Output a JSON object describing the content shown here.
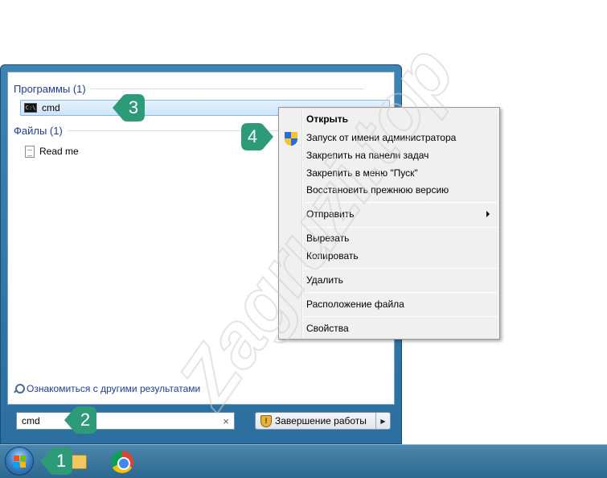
{
  "search_results": {
    "programs_header": "Программы (1)",
    "programs": [
      {
        "label": "cmd",
        "icon": "console-icon"
      }
    ],
    "files_header": "Файлы (1)",
    "files": [
      {
        "label": "Read me",
        "icon": "document-icon"
      }
    ],
    "see_more": "Ознакомиться с другими результатами"
  },
  "search": {
    "value": "cmd",
    "clear_glyph": "×"
  },
  "shutdown": {
    "label": "Завершение работы",
    "arrow_glyph": "▶"
  },
  "context_menu": {
    "items": [
      {
        "label": "Открыть",
        "bold": true
      },
      {
        "label": "Запуск от имени администратора",
        "icon": "uac-shield-icon"
      },
      {
        "label": "Закрепить на панели задач"
      },
      {
        "label": "Закрепить в меню \"Пуск\""
      },
      {
        "label": "Восстановить прежнюю версию"
      },
      {
        "label": "Отправить",
        "submenu": true
      },
      {
        "label": "Вырезать"
      },
      {
        "label": "Копировать"
      },
      {
        "label": "Удалить"
      },
      {
        "label": "Расположение файла"
      },
      {
        "label": "Свойства"
      }
    ]
  },
  "taskbar": {
    "apps": [
      "windows-explorer-icon",
      "chrome-icon"
    ]
  },
  "watermark": {
    "text": "Zagruzi.top"
  },
  "step_badges": [
    {
      "number": "1"
    },
    {
      "number": "2"
    },
    {
      "number": "3"
    },
    {
      "number": "4"
    }
  ],
  "colors": {
    "badge": "#2d9b78",
    "taskbar": "#3a78a0",
    "menu_frame": "#3d83b3"
  }
}
